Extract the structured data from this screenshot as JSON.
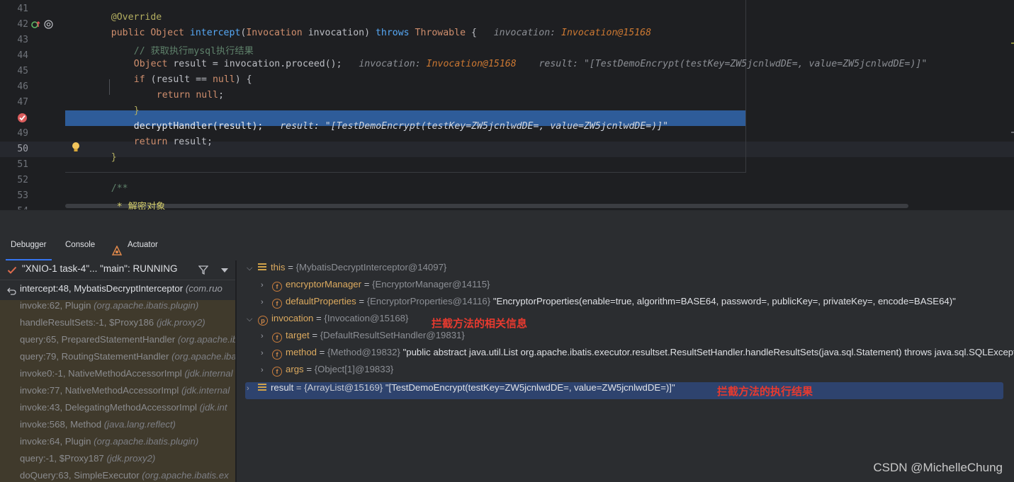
{
  "editor": {
    "gutter": [
      "41",
      "42",
      "43",
      "44",
      "45",
      "46",
      "47",
      "",
      "49",
      "50",
      "51",
      "52",
      "53",
      "54"
    ],
    "lines": {
      "l41": "@Override",
      "l42_kw_public": "public ",
      "l42_type": "Object ",
      "l42_fn": "intercept",
      "l42_paren": "(",
      "l42_ptype": "Invocation",
      "l42_param": " invocation) ",
      "l42_throws": "throws ",
      "l42_ex": "Throwable",
      "l42_brace": " {",
      "l42_hint_name": "invocation: ",
      "l42_hint_val": "Invocation@15168",
      "l43": "// 获取执行mysql执行结果",
      "l44_type": "Object ",
      "l44_code": "result = invocation.proceed();",
      "l44_hint_name": "invocation: ",
      "l44_hint_val": "Invocation@15168",
      "l44_hint2": "result: \"[TestDemoEncrypt(testKey=ZW5jcnlwdDE=, value=ZW5jcnlwdDE=)]\"",
      "l45_kw": "if ",
      "l45_code": "(result == ",
      "l45_null": "null",
      "l45_end": ") {",
      "l46_kw": "return ",
      "l46_null": "null",
      "l46_end": ";",
      "l47": "}",
      "l48_code": "decryptHandler(result);",
      "l48_hint": "result: \"[TestDemoEncrypt(testKey=ZW5jcnlwdDE=, value=ZW5jcnlwdDE=)]\"",
      "l49_kw": "return ",
      "l49_code": "result;",
      "l50": "}",
      "l52": "/**",
      "l53": " * 解密对象",
      "l54": " *"
    }
  },
  "tabs": {
    "debugger": "Debugger",
    "console": "Console",
    "actuator": "Actuator"
  },
  "thread": {
    "label": "\"XNIO-1 task-4\"... \"main\": RUNNING"
  },
  "frames": [
    {
      "method": "intercept:48, MybatisDecryptInterceptor",
      "pkg": "(com.ruo"
    },
    {
      "method": "invoke:62, Plugin",
      "pkg": "(org.apache.ibatis.plugin)"
    },
    {
      "method": "handleResultSets:-1, $Proxy186",
      "pkg": "(jdk.proxy2)"
    },
    {
      "method": "query:65, PreparedStatementHandler",
      "pkg": "(org.apache.ib"
    },
    {
      "method": "query:79, RoutingStatementHandler",
      "pkg": "(org.apache.ibat"
    },
    {
      "method": "invoke0:-1, NativeMethodAccessorImpl",
      "pkg": "(jdk.internal"
    },
    {
      "method": "invoke:77, NativeMethodAccessorImpl",
      "pkg": "(jdk.internal"
    },
    {
      "method": "invoke:43, DelegatingMethodAccessorImpl",
      "pkg": "(jdk.int"
    },
    {
      "method": "invoke:568, Method",
      "pkg": "(java.lang.reflect)"
    },
    {
      "method": "invoke:64, Plugin",
      "pkg": "(org.apache.ibatis.plugin)"
    },
    {
      "method": "query:-1, $Proxy187",
      "pkg": "(jdk.proxy2)"
    },
    {
      "method": "doQuery:63, SimpleExecutor",
      "pkg": "(org.apache.ibatis.ex"
    }
  ],
  "variables": {
    "this": {
      "name": "this",
      "ref": "{MybatisDecryptInterceptor@14097}"
    },
    "encryptorManager": {
      "name": "encryptorManager",
      "ref": "{EncryptorManager@14115}"
    },
    "defaultProperties": {
      "name": "defaultProperties",
      "ref": "{EncryptorProperties@14116}",
      "val": "\"EncryptorProperties(enable=true, algorithm=BASE64, password=, publicKey=, privateKey=, encode=BASE64)\""
    },
    "invocation": {
      "name": "invocation",
      "ref": "{Invocation@15168}"
    },
    "target": {
      "name": "target",
      "ref": "{DefaultResultSetHandler@19831}"
    },
    "method": {
      "name": "method",
      "ref": "{Method@19832}",
      "val": "\"public abstract java.util.List org.apache.ibatis.executor.resultset.ResultSetHandler.handleResultSets(java.sql.Statement) throws java.sql.SQLException\""
    },
    "args": {
      "name": "args",
      "ref": "{Object[1]@19833}"
    },
    "result": {
      "name": "result",
      "ref": "{ArrayList@15169}",
      "val": "\"[TestDemoEncrypt(testKey=ZW5jcnlwdDE=, value=ZW5jcnlwdDE=)]\""
    },
    "eq": " = "
  },
  "annotations": {
    "invocation_note": "拦截方法的相关信息",
    "result_note": "拦截方法的执行结果"
  },
  "watermark": "CSDN @MichelleChung",
  "colors": {
    "accent": "#3574f0",
    "breakpoint_row": "#2e5c99",
    "annotation_red": "#e83a2f"
  }
}
